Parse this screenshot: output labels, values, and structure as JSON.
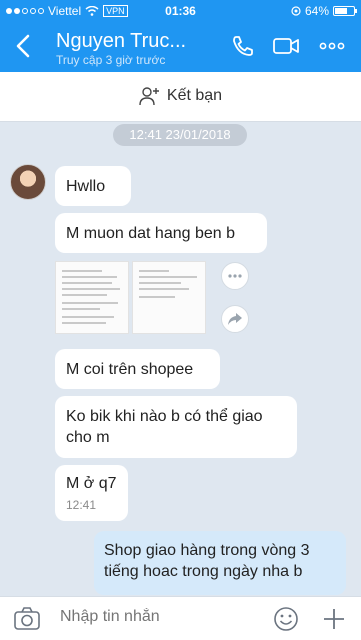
{
  "status_bar": {
    "carrier": "Viettel",
    "vpn": "VPN",
    "time": "01:36",
    "battery": "64%",
    "battery_level": 0.64
  },
  "header": {
    "title": "Nguyen Truc...",
    "subtitle": "Truy cập 3 giờ trước",
    "back_icon": "chevron-left-icon",
    "call_icon": "phone-icon",
    "video_icon": "video-icon",
    "more_icon": "more-icon"
  },
  "add_friend": {
    "label": "Kết bạn"
  },
  "chat": {
    "date_label": "12:41 23/01/2018",
    "messages": [
      {
        "text": "Hwllo"
      },
      {
        "text": "M muon dat hang ben b"
      },
      {
        "text": "M coi trên shopee"
      },
      {
        "text": "Ko bik khi nào b có thể giao cho m"
      },
      {
        "text": "M ở q7",
        "time": "12:41"
      },
      {
        "text": "Shop giao hàng trong vòng 3 tiếng hoac trong ngày nha b"
      }
    ]
  },
  "composer": {
    "placeholder": "Nhập tin nhắn"
  },
  "colors": {
    "header": "#1f96f2",
    "chat_bg": "#dfe7f0",
    "own_bubble": "#d5e9fa"
  }
}
